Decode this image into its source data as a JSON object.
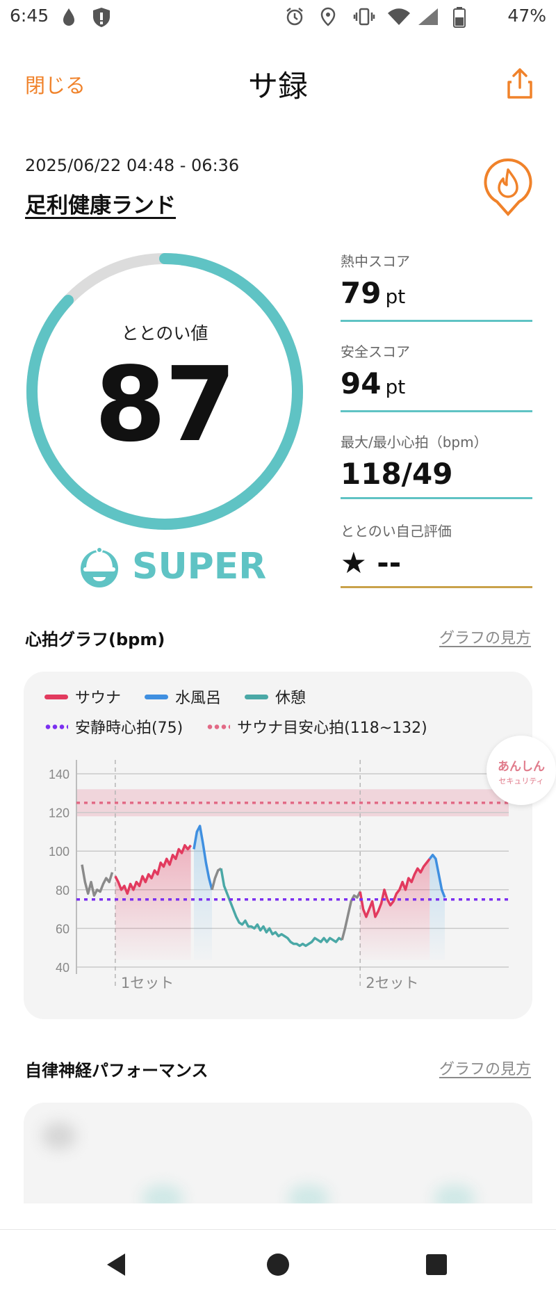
{
  "status_bar": {
    "time": "6:45",
    "battery": "47%",
    "icons": [
      "drop-icon",
      "shield-icon",
      "alarm-icon",
      "location-icon",
      "vibrate-icon",
      "wifi-icon",
      "signal-icon",
      "battery-icon"
    ]
  },
  "header": {
    "close_label": "閉じる",
    "title": "サ録",
    "share_icon": "share-icon",
    "accent_color": "#f0822a"
  },
  "session": {
    "datetime": "2025/06/22 04:48 - 06:36",
    "place": "足利健康ランド",
    "badge_icon": "fire-icon"
  },
  "totonoi": {
    "label": "ととのい値",
    "value": "87",
    "progress": 0.87,
    "rank": "SUPER",
    "rank_icon": "sauna-hat-icon",
    "ring_color": "#5fc3c4"
  },
  "scores": [
    {
      "label": "熱中スコア",
      "value": "79",
      "unit": "pt"
    },
    {
      "label": "安全スコア",
      "value": "94",
      "unit": "pt"
    },
    {
      "label": "最大/最小心拍（bpm）",
      "value": "118/49",
      "unit": ""
    }
  ],
  "self_eval": {
    "label": "ととのい自己評価",
    "star": "★",
    "value": "--"
  },
  "hr_section": {
    "title": "心拍グラフ(bpm)",
    "link": "グラフの見方"
  },
  "legend": {
    "sauna": "サウナ",
    "water": "水風呂",
    "rest": "休憩",
    "resting_hr": "安静時心拍(75)",
    "sauna_target": "サウナ目安心拍(118~132)"
  },
  "security_badge": {
    "line1": "あんしん",
    "line2": "セキュリティ"
  },
  "chart_data": {
    "type": "line",
    "xlabel": "",
    "ylabel": "",
    "ylim": [
      40,
      140
    ],
    "yticks": [
      140,
      120,
      100,
      80,
      60,
      40
    ],
    "x_annotations": [
      "1セット",
      "2セット"
    ],
    "reference_lines": [
      {
        "name": "安静時心拍(75)",
        "value": 75,
        "color": "#7b2ff0"
      }
    ],
    "reference_bands": [
      {
        "name": "サウナ目安心拍(118~132)",
        "from": 118,
        "to": 132,
        "line": 125,
        "color": "#e26a86"
      }
    ],
    "colors": {
      "sauna": "#e23a5e",
      "water": "#3f8fe0",
      "rest": "#4aa8a6",
      "other": "#8a8a8a"
    },
    "series": [
      {
        "name": "other",
        "values": [
          [
            0,
            93
          ],
          [
            1,
            84
          ],
          [
            2,
            78
          ],
          [
            3,
            84
          ],
          [
            4,
            77
          ],
          [
            5,
            80
          ],
          [
            6,
            79
          ],
          [
            7,
            83
          ],
          [
            8,
            86
          ],
          [
            9,
            84
          ],
          [
            10,
            89
          ]
        ]
      },
      {
        "name": "サウナ",
        "values": [
          [
            11,
            87
          ],
          [
            12,
            84
          ],
          [
            13,
            80
          ],
          [
            14,
            82
          ],
          [
            15,
            78
          ],
          [
            16,
            83
          ],
          [
            17,
            80
          ],
          [
            18,
            84
          ],
          [
            19,
            82
          ],
          [
            20,
            87
          ],
          [
            21,
            84
          ],
          [
            22,
            88
          ],
          [
            23,
            86
          ],
          [
            24,
            90
          ],
          [
            25,
            88
          ],
          [
            26,
            94
          ],
          [
            27,
            92
          ],
          [
            28,
            96
          ],
          [
            29,
            93
          ],
          [
            30,
            98
          ],
          [
            31,
            96
          ],
          [
            32,
            101
          ],
          [
            33,
            99
          ],
          [
            34,
            103
          ],
          [
            35,
            101
          ],
          [
            36,
            103
          ]
        ]
      },
      {
        "name": "水風呂",
        "values": [
          [
            37,
            101
          ],
          [
            38,
            110
          ],
          [
            39,
            113
          ],
          [
            40,
            104
          ],
          [
            41,
            94
          ],
          [
            42,
            86
          ],
          [
            43,
            80
          ]
        ]
      },
      {
        "name": "other",
        "values": [
          [
            43,
            80
          ],
          [
            44,
            86
          ],
          [
            45,
            90
          ],
          [
            46,
            91
          ]
        ]
      },
      {
        "name": "休憩",
        "values": [
          [
            46,
            91
          ],
          [
            47,
            82
          ],
          [
            48,
            78
          ],
          [
            49,
            74
          ],
          [
            50,
            70
          ],
          [
            51,
            66
          ],
          [
            52,
            63
          ],
          [
            53,
            62
          ],
          [
            54,
            64
          ],
          [
            55,
            61
          ],
          [
            56,
            61
          ],
          [
            57,
            60
          ],
          [
            58,
            62
          ],
          [
            59,
            59
          ],
          [
            60,
            61
          ],
          [
            61,
            58
          ],
          [
            62,
            60
          ],
          [
            63,
            57
          ],
          [
            64,
            58
          ],
          [
            65,
            56
          ],
          [
            66,
            57
          ],
          [
            67,
            56
          ],
          [
            68,
            55
          ],
          [
            69,
            53
          ],
          [
            70,
            52
          ],
          [
            71,
            52
          ],
          [
            72,
            51
          ],
          [
            73,
            52
          ],
          [
            74,
            51
          ],
          [
            75,
            52
          ],
          [
            76,
            53
          ],
          [
            77,
            55
          ],
          [
            78,
            54
          ],
          [
            79,
            53
          ],
          [
            80,
            55
          ],
          [
            81,
            53
          ],
          [
            82,
            55
          ],
          [
            83,
            54
          ],
          [
            84,
            53
          ],
          [
            85,
            55
          ],
          [
            86,
            54
          ]
        ]
      },
      {
        "name": "other",
        "values": [
          [
            86,
            54
          ],
          [
            87,
            60
          ],
          [
            88,
            67
          ],
          [
            89,
            74
          ],
          [
            90,
            77
          ],
          [
            91,
            76
          ],
          [
            92,
            79
          ]
        ]
      },
      {
        "name": "サウナ",
        "values": [
          [
            92,
            79
          ],
          [
            93,
            70
          ],
          [
            94,
            66
          ],
          [
            95,
            70
          ],
          [
            96,
            74
          ],
          [
            97,
            66
          ],
          [
            98,
            69
          ],
          [
            99,
            73
          ],
          [
            100,
            80
          ],
          [
            101,
            75
          ],
          [
            102,
            72
          ],
          [
            103,
            74
          ],
          [
            104,
            78
          ],
          [
            105,
            80
          ],
          [
            106,
            84
          ],
          [
            107,
            80
          ],
          [
            108,
            86
          ],
          [
            109,
            84
          ],
          [
            110,
            88
          ],
          [
            111,
            91
          ],
          [
            112,
            89
          ],
          [
            113,
            92
          ],
          [
            114,
            94
          ],
          [
            115,
            96
          ]
        ]
      },
      {
        "name": "水風呂",
        "values": [
          [
            115,
            96
          ],
          [
            116,
            98
          ],
          [
            117,
            96
          ],
          [
            118,
            88
          ],
          [
            119,
            80
          ],
          [
            120,
            76
          ]
        ]
      }
    ]
  },
  "ans_section": {
    "title": "自律神経パフォーマンス",
    "link": "グラフの見方"
  },
  "nav": {
    "back_icon": "back-icon",
    "home_icon": "home-icon",
    "recents_icon": "recents-icon"
  }
}
